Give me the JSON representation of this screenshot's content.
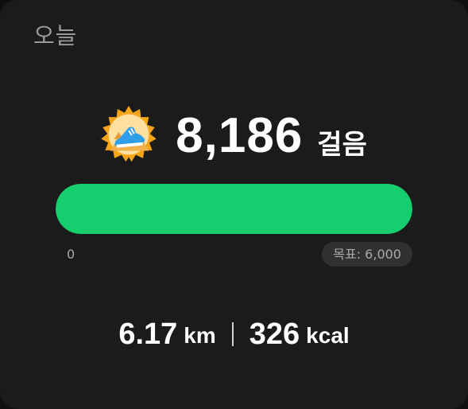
{
  "header": {
    "title": "오늘"
  },
  "steps": {
    "count": "8,186",
    "unit": "걸음",
    "badge_icon": "sneaker-badge-icon"
  },
  "progress": {
    "min_label": "0",
    "goal_label": "목표: 6,000",
    "fraction": 1.0,
    "color": "#15cf6f"
  },
  "stats": {
    "distance_value": "6.17",
    "distance_unit": "km",
    "calories_value": "326",
    "calories_unit": "kcal"
  }
}
